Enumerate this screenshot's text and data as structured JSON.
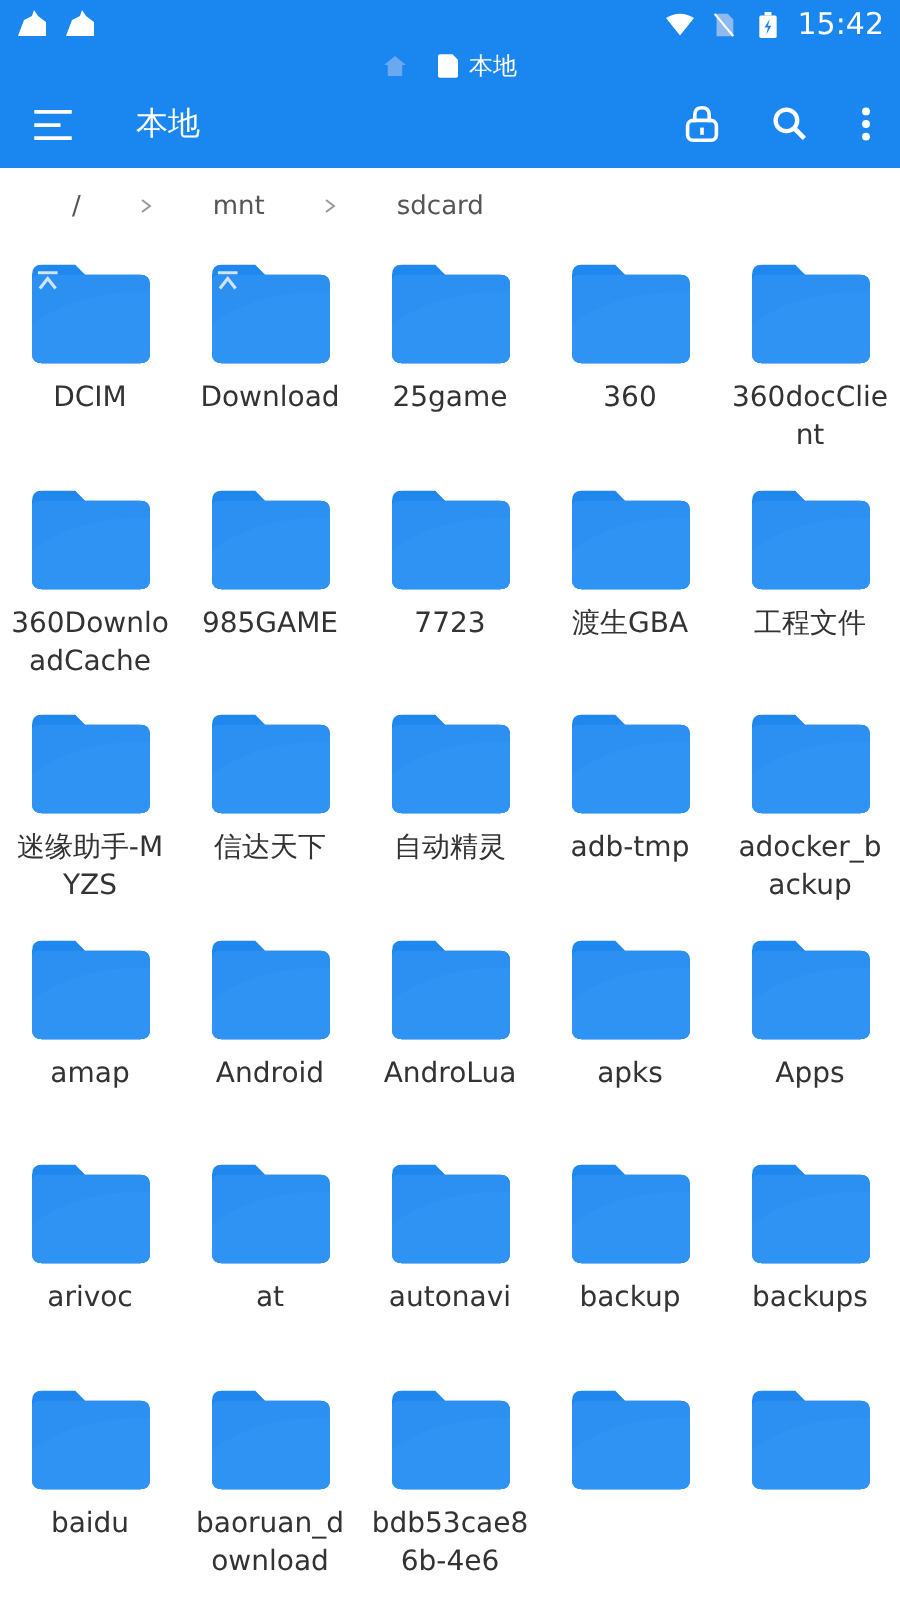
{
  "status_bar": {
    "time": "15:42"
  },
  "title_strip": {
    "title": "本地"
  },
  "toolbar": {
    "title": "本地"
  },
  "breadcrumb": [
    "/",
    "mnt",
    "sdcard"
  ],
  "folders": [
    {
      "name": "DCIM",
      "kind": "marked"
    },
    {
      "name": "Download",
      "kind": "marked"
    },
    {
      "name": "25game",
      "kind": "plain"
    },
    {
      "name": "360",
      "kind": "plain"
    },
    {
      "name": "360docClient",
      "kind": "plain"
    },
    {
      "name": "360DownloadCache",
      "kind": "plain"
    },
    {
      "name": "985GAME",
      "kind": "plain"
    },
    {
      "name": "7723",
      "kind": "plain"
    },
    {
      "name": "渡生GBA",
      "kind": "plain"
    },
    {
      "name": "工程文件",
      "kind": "plain"
    },
    {
      "name": "迷缘助手-MYZS",
      "kind": "plain"
    },
    {
      "name": "信达天下",
      "kind": "plain"
    },
    {
      "name": "自动精灵",
      "kind": "plain"
    },
    {
      "name": "adb-tmp",
      "kind": "plain"
    },
    {
      "name": "adocker_backup",
      "kind": "plain"
    },
    {
      "name": "amap",
      "kind": "plain"
    },
    {
      "name": "Android",
      "kind": "plain"
    },
    {
      "name": "AndroLua",
      "kind": "plain"
    },
    {
      "name": "apks",
      "kind": "plain"
    },
    {
      "name": "Apps",
      "kind": "plain"
    },
    {
      "name": "arivoc",
      "kind": "plain"
    },
    {
      "name": "at",
      "kind": "plain"
    },
    {
      "name": "autonavi",
      "kind": "plain"
    },
    {
      "name": "backup",
      "kind": "plain"
    },
    {
      "name": "backups",
      "kind": "plain"
    },
    {
      "name": "baidu",
      "kind": "plain"
    },
    {
      "name": "baoruan_download",
      "kind": "plain"
    },
    {
      "name": "bdb53cae86b-4e6",
      "kind": "plain"
    },
    {
      "kind": "plain"
    },
    {
      "kind": "plain"
    }
  ]
}
